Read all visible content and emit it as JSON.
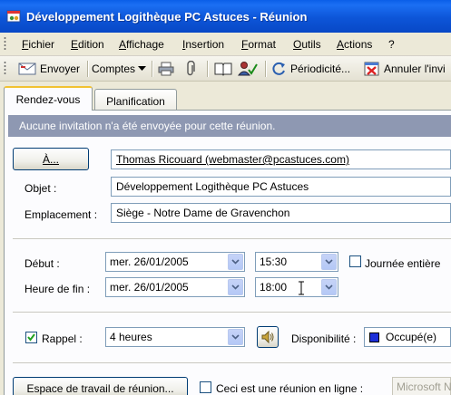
{
  "window": {
    "title": "Développement Logithèque PC Astuces - Réunion"
  },
  "menu": {
    "items": [
      "Fichier",
      "Edition",
      "Affichage",
      "Insertion",
      "Format",
      "Outils",
      "Actions",
      "?"
    ]
  },
  "toolbar": {
    "send_label": "Envoyer",
    "accounts_label": "Comptes",
    "recurrence_label": "Périodicité...",
    "cancel_invitation_label": "Annuler l'invi"
  },
  "tabs": {
    "appointment": "Rendez-vous",
    "scheduling": "Planification"
  },
  "info_bar": {
    "text": "Aucune invitation n'a été envoyée pour cette réunion."
  },
  "form": {
    "to_button": "À...",
    "to_value": "Thomas Ricouard (webmaster@pcastuces.com)",
    "subject_label": "Objet :",
    "subject_value": "Développement Logithèque PC Astuces",
    "location_label": "Emplacement :",
    "location_value": "Siège - Notre Dame de Gravenchon",
    "start_label": "Début :",
    "start_date": "mer. 26/01/2005",
    "start_time": "15:30",
    "all_day_label": "Journée entière",
    "all_day_checked": false,
    "end_label": "Heure de fin :",
    "end_date": "mer. 26/01/2005",
    "end_time": "18:00",
    "reminder_label": "Rappel :",
    "reminder_checked": true,
    "reminder_value": "4 heures",
    "availability_label": "Disponibilité :",
    "availability_value": "Occupé(e)",
    "availability_color": "#1d2fd8",
    "workspace_button": "Espace de travail de réunion...",
    "online_meeting_label": "Ceci est une réunion en ligne :",
    "online_meeting_checked": false,
    "online_provider_value": "Microsoft N"
  },
  "colors": {
    "title_bar": "#0a5ee8",
    "info_bar": "#8e98b2",
    "tab_highlight": "#f1c232"
  }
}
